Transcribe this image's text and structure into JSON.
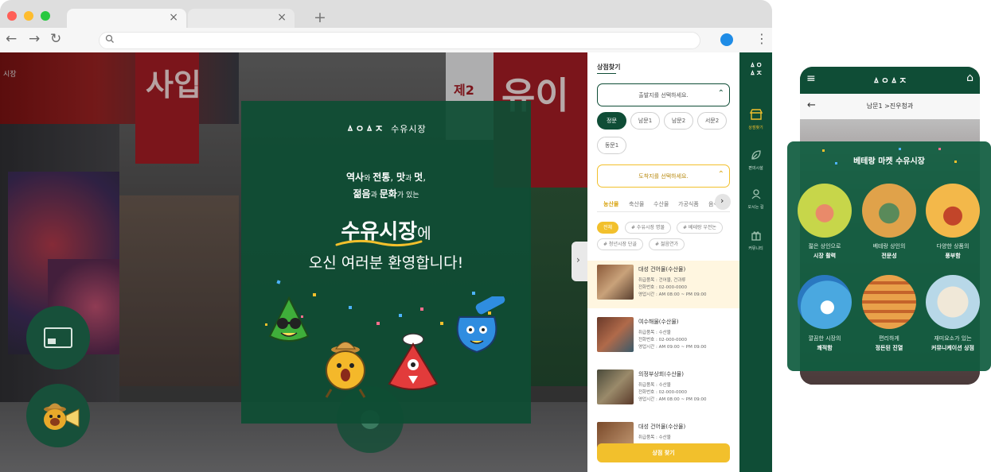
{
  "browser": {
    "traffic_lights": [
      "#ff5f57",
      "#febc2e",
      "#28c840"
    ],
    "new_tab_label": "+",
    "tab_close": "×",
    "back": "←",
    "forward": "→",
    "reload": "↻",
    "search_icon": "search-icon",
    "menu": "⋮"
  },
  "scene": {
    "signs": [
      "사입",
      "유이",
      "제2"
    ],
    "top_label": "시장"
  },
  "welcome": {
    "logo": "ㅿㅇㅿㅈ",
    "brand": "수유시장",
    "line1_a": "역사",
    "line1_b": "와 ",
    "line1_c": "전통",
    "line1_d": ", ",
    "line1_e": "맛",
    "line1_f": "과 ",
    "line1_g": "멋",
    "line1_h": ",",
    "line2_a": "젊음",
    "line2_b": "과 ",
    "line2_c": "문화",
    "line2_d": "가 있는",
    "big_name": "수유시장",
    "big_suffix": "에",
    "welcome_line": "오신 여러분 환영합니다!"
  },
  "panel": {
    "title": "상점찾기",
    "select1": "출발지를 선택하세요.",
    "gates": [
      "정문",
      "남문1",
      "남문2",
      "서문2",
      "동문1"
    ],
    "select2": "도착지를 선택하세요.",
    "categories": [
      "농산물",
      "축산물",
      "수산물",
      "가공식품",
      "음식"
    ],
    "tags": [
      "전체",
      "# 수유시장 명물",
      "# 베테랑 우전논",
      "# 청년시장 단골",
      "# 젊음연가"
    ],
    "stores": [
      {
        "name": "대성 건어물(수산물)",
        "l1": "취급품목 : 건어물, 건과류",
        "l2": "전화번호 : 02-000-0000",
        "l3": "영업시간 : AM 08:00 ~ PM 09:00"
      },
      {
        "name": "여수해물(수산물)",
        "l1": "취급품목 : 수산물",
        "l2": "전화번호 : 02-000-0000",
        "l3": "영업시간 : AM 09:00 ~ PM 09:00"
      },
      {
        "name": "의정부상회(수산물)",
        "l1": "취급품목 : 수산물",
        "l2": "전화번호 : 02-000-0000",
        "l3": "영업시간 : AM 08:00 ~ PM 09:00"
      },
      {
        "name": "대성 건어물(수산물)",
        "l1": "취급품목 : 수산물",
        "l2": "",
        "l3": ""
      }
    ],
    "find_button": "상점 찾기",
    "next": "›",
    "collapse": "›",
    "accent": "#f2c02c",
    "green": "#0f4d36"
  },
  "nav_strip": {
    "logo": "ㅿㅇ\nㅿㅈ",
    "items": [
      {
        "icon": "shop-icon",
        "label": "상점찾기"
      },
      {
        "icon": "leaf-icon",
        "label": "편의시설"
      },
      {
        "icon": "person-icon",
        "label": "오시는 길"
      },
      {
        "icon": "gift-icon",
        "label": "커뮤니티"
      }
    ]
  },
  "phone": {
    "menu": "≡",
    "logo": "ㅿㅇㅿㅈ",
    "home": "⌂",
    "back": "←",
    "breadcrumb": "남문1 >진우청과",
    "card_title": "베테랑 마켓 수유시장",
    "items": [
      {
        "a": "젊은 상인으로",
        "b": "시장 활력"
      },
      {
        "a": "베테랑 상인의",
        "b": "전문성"
      },
      {
        "a": "다양한 상품의",
        "b": "풍부함"
      },
      {
        "a": "깔끔한 시장의",
        "b": "쾌적함"
      },
      {
        "a": "편리하게",
        "b": "정돈된 진열"
      },
      {
        "a": "재미요소가 있는",
        "b": "커뮤니케이션 상점"
      }
    ]
  }
}
